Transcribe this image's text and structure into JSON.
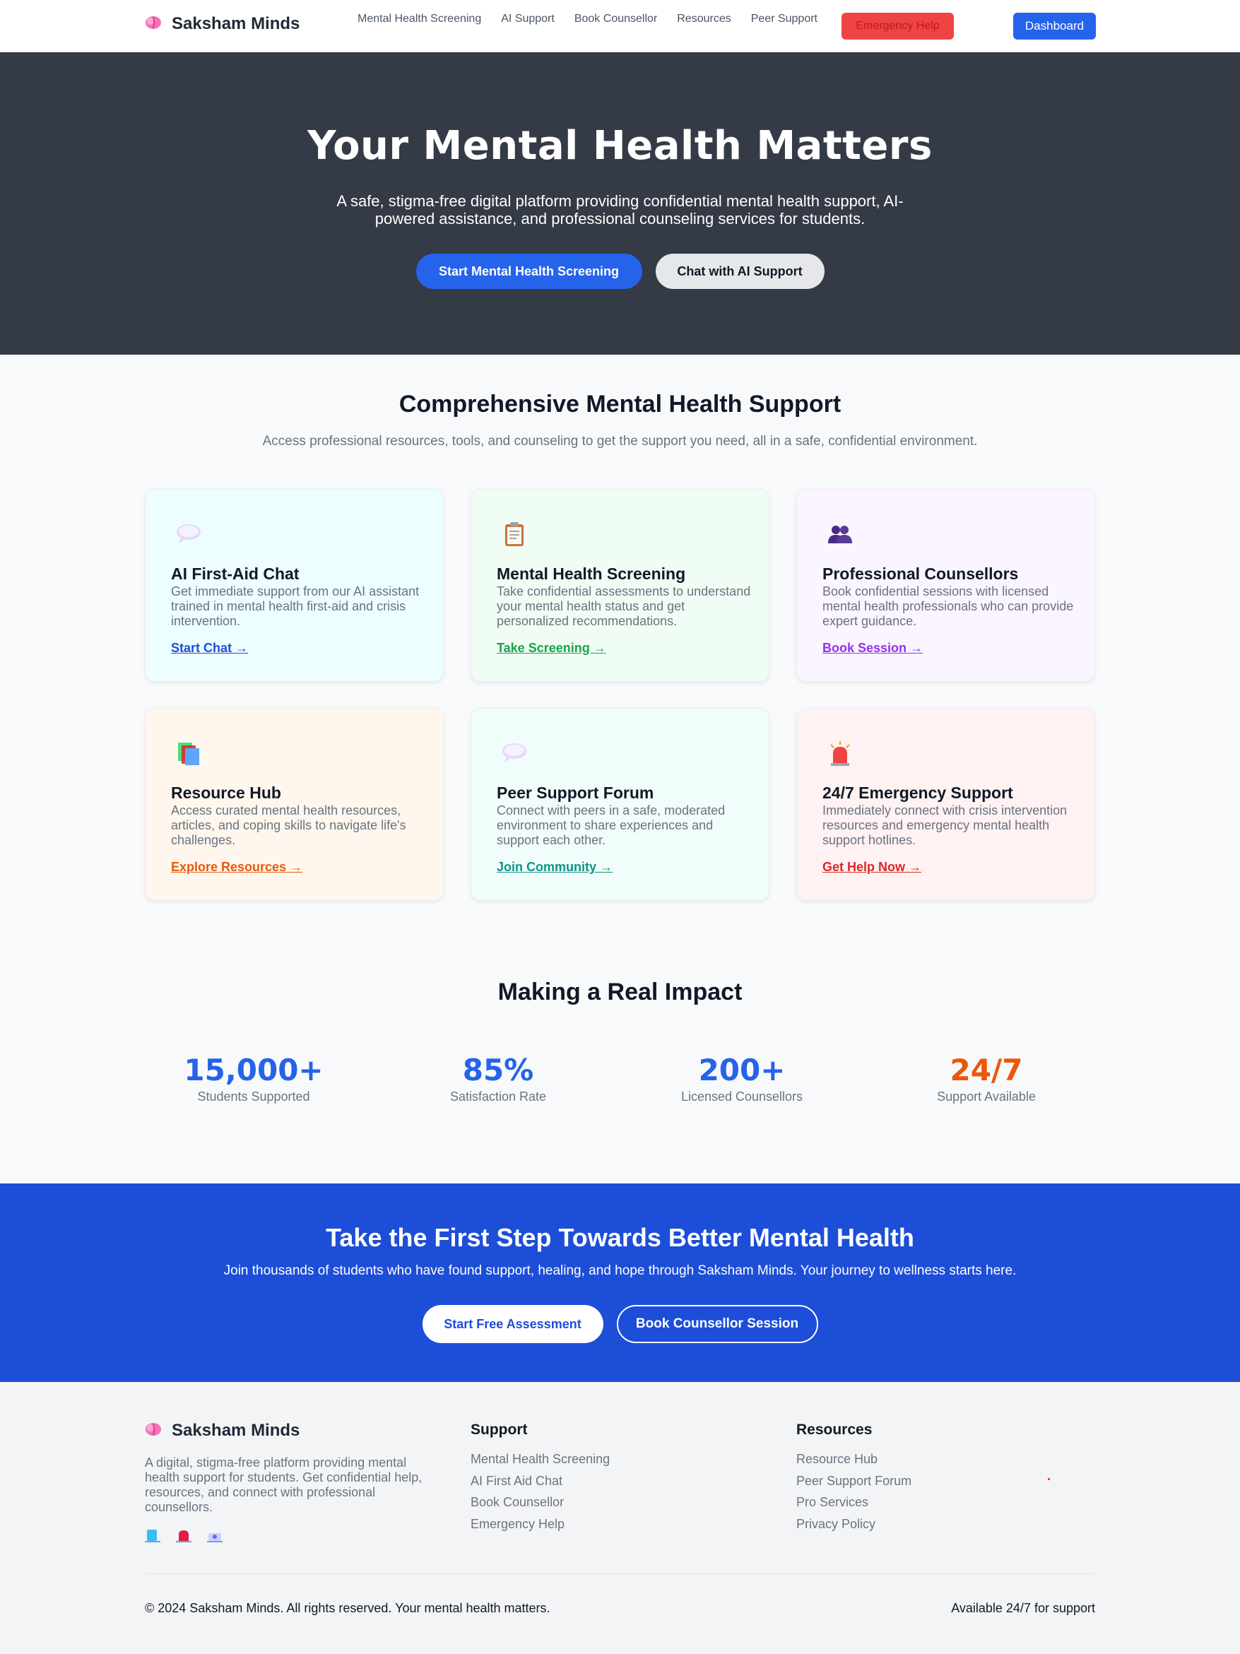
{
  "nav": {
    "brand": "Saksham Minds",
    "links": [
      "Mental Health Screening",
      "AI Support",
      "Book Counsellor",
      "Resources",
      "Peer Support"
    ],
    "emergency_label": "Emergency Help",
    "dashboard_label": "Dashboard"
  },
  "hero": {
    "title": "Your Mental Health Matters",
    "subtitle": "A safe, stigma-free digital platform providing confidential mental health support, AI-powered assistance, and professional counseling services for students.",
    "primary_btn": "Start Mental Health Screening",
    "secondary_btn": "Chat with AI Support"
  },
  "features": {
    "title": "Comprehensive Mental Health Support",
    "subtitle": "Access professional resources, tools, and counseling to get the support you need, all in a safe, confidential environment.",
    "cards": [
      {
        "icon": "speech-bubble-icon",
        "title": "AI First-Aid Chat",
        "desc": "Get immediate support from our AI assistant trained in mental health first-aid and crisis intervention.",
        "link": "Start Chat →",
        "bg": "#ecfeff",
        "accent": "#1d4ed8"
      },
      {
        "icon": "clipboard-icon",
        "title": "Mental Health Screening",
        "desc": "Take confidential assessments to understand your mental health status and get personalized recommendations.",
        "link": "Take Screening →",
        "bg": "#f0fdf4",
        "accent": "#16a34a"
      },
      {
        "icon": "people-icon",
        "title": "Professional Counsellors",
        "desc": "Book confidential sessions with licensed mental health professionals who can provide expert guidance.",
        "link": "Book Session →",
        "bg": "#faf5ff",
        "accent": "#9333ea"
      },
      {
        "icon": "books-icon",
        "title": "Resource Hub",
        "desc": "Access curated mental health resources, articles, and coping skills to navigate life's challenges.",
        "link": "Explore Resources →",
        "bg": "#fff7ed",
        "accent": "#ea580c"
      },
      {
        "icon": "speech-bubble-icon",
        "title": "Peer Support Forum",
        "desc": "Connect with peers in a safe, moderated environment to share experiences and support each other.",
        "link": "Join Community →",
        "bg": "#f0fdfa",
        "accent": "#0d9488"
      },
      {
        "icon": "siren-icon",
        "title": "24/7 Emergency Support",
        "desc": "Immediately connect with crisis intervention resources and emergency mental health support hotlines.",
        "link": "Get Help Now →",
        "bg": "#fef2f2",
        "accent": "#dc2626"
      }
    ]
  },
  "impact": {
    "title": "Making a Real Impact",
    "stats": [
      {
        "value": "15,000+",
        "label": "Students Supported",
        "color": "#2563eb"
      },
      {
        "value": "85%",
        "label": "Satisfaction Rate",
        "color": "#2563eb"
      },
      {
        "value": "200+",
        "label": "Licensed Counsellors",
        "color": "#2563eb"
      },
      {
        "value": "24/7",
        "label": "Support Available",
        "color": "#ea580c"
      }
    ]
  },
  "cta": {
    "title": "Take the First Step Towards Better Mental Health",
    "subtitle": "Join thousands of students who have found support, healing, and hope through Saksham Minds. Your journey to wellness starts here.",
    "primary_btn": "Start Free Assessment",
    "secondary_btn": "Book Counsellor Session"
  },
  "footer": {
    "brand": "Saksham Minds",
    "desc": "A digital, stigma-free platform providing mental health support for students. Get confidential help, resources, and connect with professional counsellors.",
    "social_icons": [
      "phone-icon",
      "chat-icon",
      "email-icon"
    ],
    "support": {
      "title": "Support",
      "items": [
        "Mental Health Screening",
        "AI First Aid Chat",
        "Book Counsellor",
        "Emergency Help"
      ]
    },
    "resources": {
      "title": "Resources",
      "items": [
        "Resource Hub",
        "Peer Support Forum",
        "Pro Services",
        "Privacy Policy"
      ]
    },
    "copyright": "© 2024 Saksham Minds. All rights reserved. Your mental health matters.",
    "availability": "Available 24/7 for support"
  }
}
